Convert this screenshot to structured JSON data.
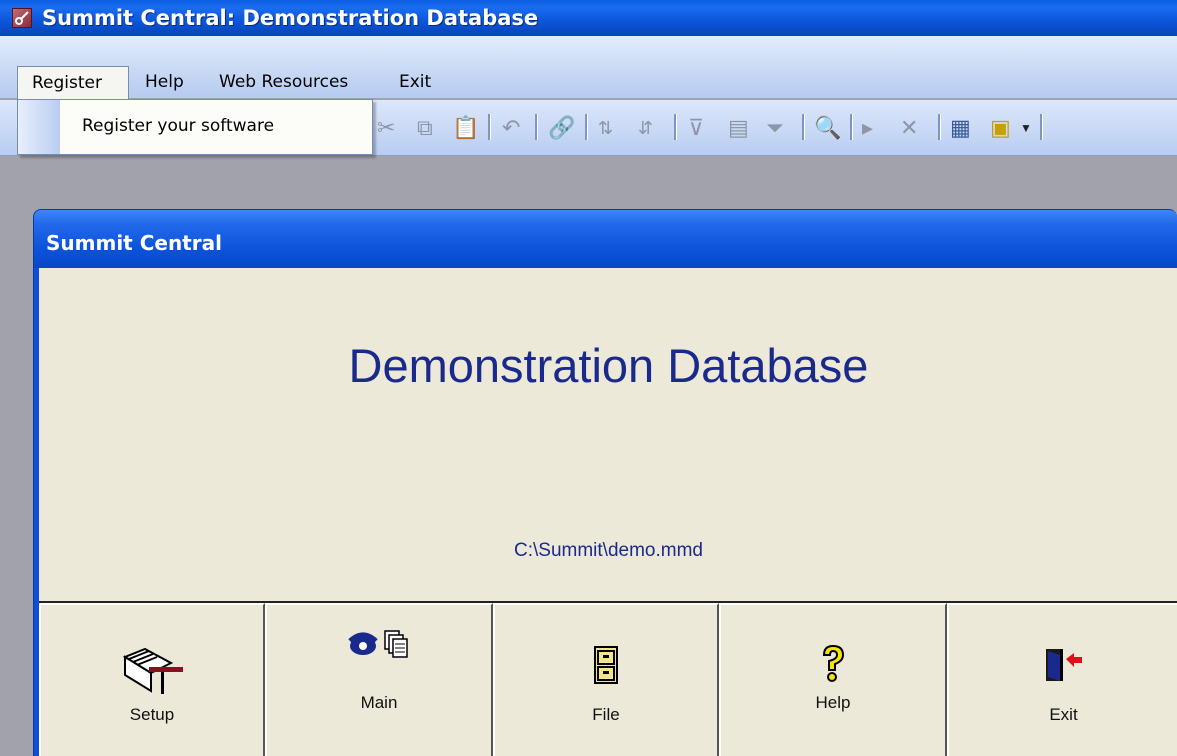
{
  "window": {
    "title": "Summit Central: Demonstration Database",
    "icon": "access-key-icon"
  },
  "menubar": {
    "items": [
      {
        "label": "Register"
      },
      {
        "label": "Help"
      },
      {
        "label": "Web Resources"
      },
      {
        "label": "Exit"
      }
    ],
    "open_menu": {
      "items": [
        {
          "label": "Register your software"
        }
      ]
    }
  },
  "toolbar": {
    "icons": [
      "cut-icon",
      "copy-icon",
      "paste-icon",
      "undo-icon",
      "hyperlink-icon",
      "sort-ascending-icon",
      "sort-descending-icon",
      "filter-by-selection-icon",
      "filter-by-form-icon",
      "apply-filter-icon",
      "find-icon",
      "new-record-icon",
      "delete-record-icon",
      "database-window-icon",
      "new-object-icon"
    ]
  },
  "form": {
    "title": "Summit Central",
    "heading": "Demonstration Database",
    "path": "C:\\Summit\\demo.mmd",
    "buttons": [
      {
        "label": "Setup",
        "icon": "setup-notebook-icon"
      },
      {
        "label": "Main",
        "icon": "phone-and-cards-icon"
      },
      {
        "label": "File",
        "icon": "file-cabinet-icon"
      },
      {
        "label": "Help",
        "icon": "question-mark-icon"
      },
      {
        "label": "Exit",
        "icon": "exit-door-icon"
      }
    ]
  },
  "colors": {
    "heading_text": "#1a2a8c",
    "form_background": "#ece9d8",
    "title_bar": "#0b55d8"
  }
}
